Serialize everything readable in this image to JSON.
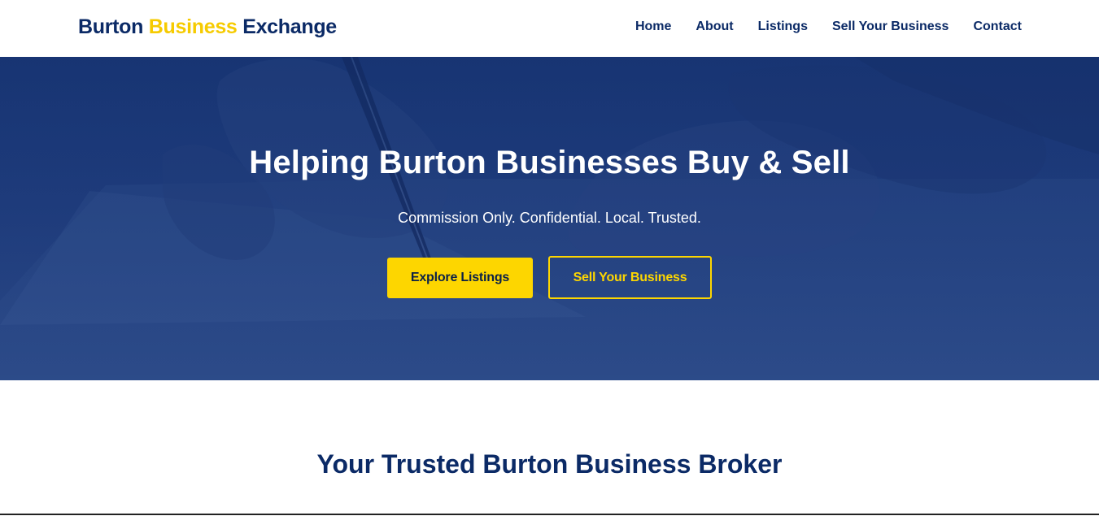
{
  "header": {
    "logo": {
      "part1": "Burton ",
      "part2": "Business",
      "part3": " Exchange"
    },
    "nav": [
      {
        "label": "Home"
      },
      {
        "label": "About"
      },
      {
        "label": "Listings"
      },
      {
        "label": "Sell Your Business"
      },
      {
        "label": "Contact"
      }
    ]
  },
  "hero": {
    "title": "Helping Burton Businesses Buy & Sell",
    "subtitle": "Commission Only. Confidential. Local. Trusted.",
    "primary_button": "Explore Listings",
    "secondary_button": "Sell Your Business"
  },
  "section": {
    "title": "Your Trusted Burton Business Broker"
  },
  "colors": {
    "brand_navy": "#0b2a66",
    "accent_yellow": "#fdd600",
    "hero_overlay": "#223f80"
  }
}
